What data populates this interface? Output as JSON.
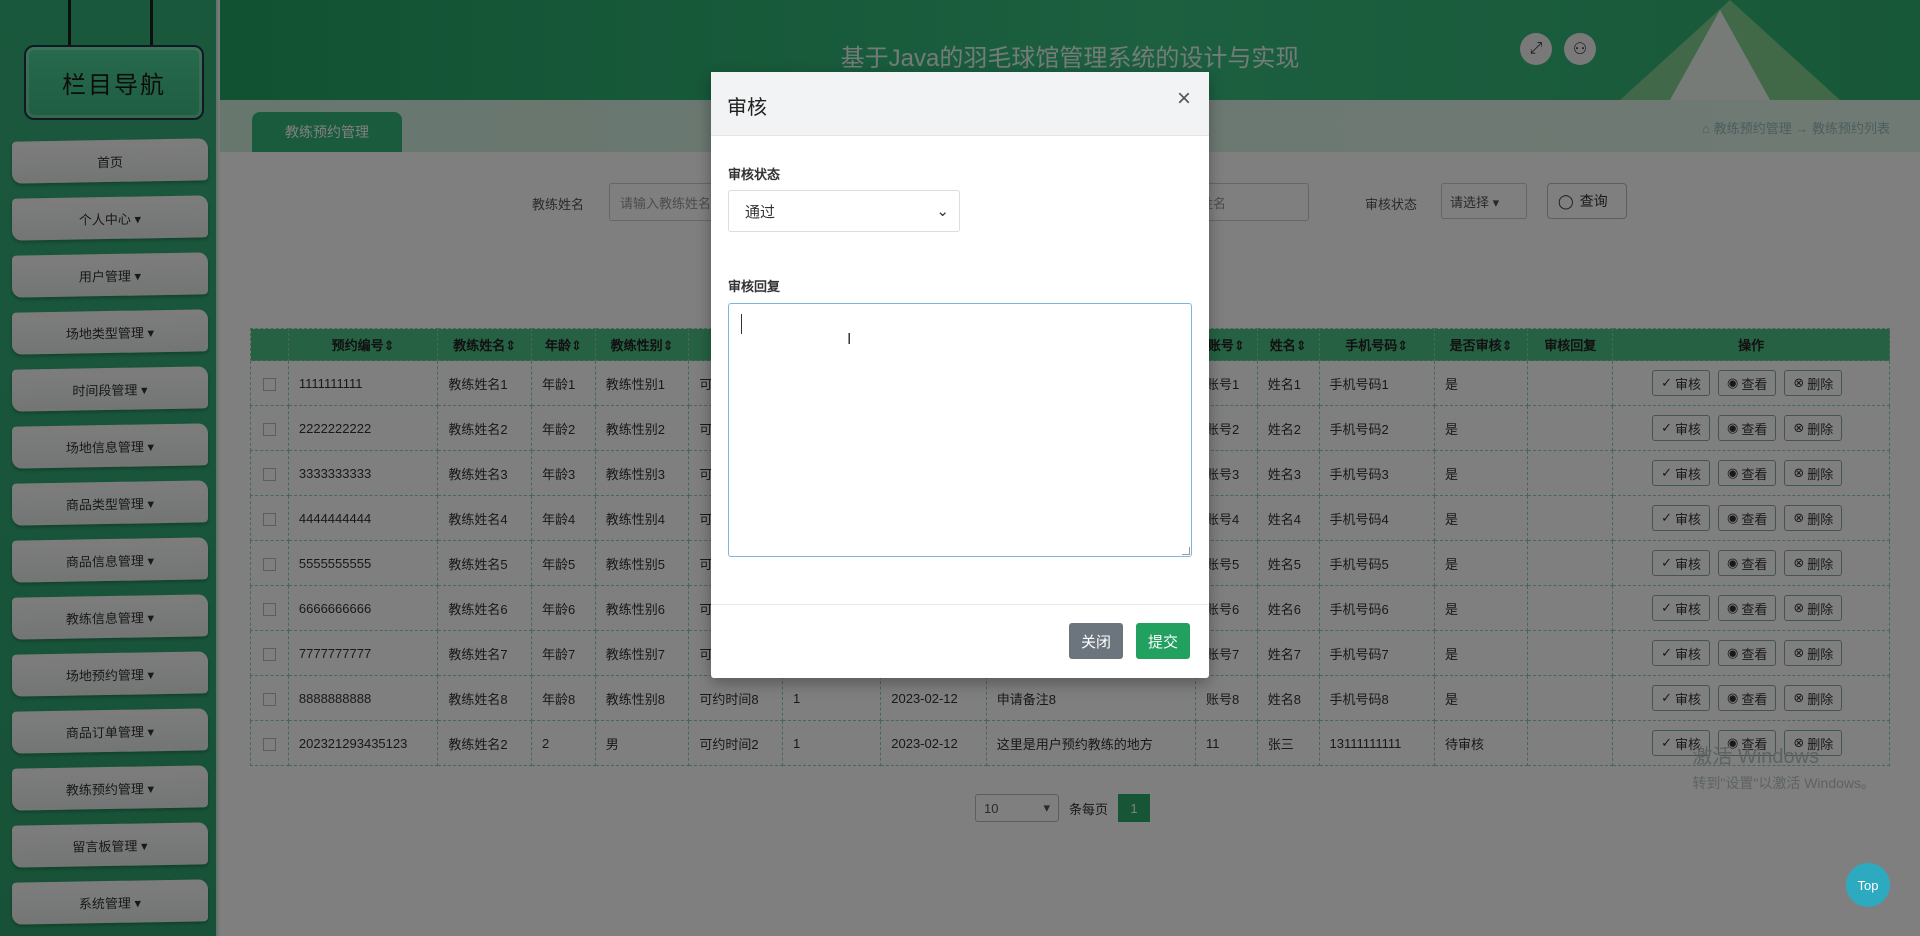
{
  "sidebar": {
    "title": "栏目导航",
    "items": [
      {
        "label": "首页"
      },
      {
        "label": "个人中心 ▾"
      },
      {
        "label": "用户管理 ▾"
      },
      {
        "label": "场地类型管理 ▾"
      },
      {
        "label": "时间段管理 ▾"
      },
      {
        "label": "场地信息管理 ▾"
      },
      {
        "label": "商品类型管理 ▾"
      },
      {
        "label": "商品信息管理 ▾"
      },
      {
        "label": "教练信息管理 ▾"
      },
      {
        "label": "场地预约管理 ▾"
      },
      {
        "label": "商品订单管理 ▾"
      },
      {
        "label": "教练预约管理 ▾"
      },
      {
        "label": "留言板管理 ▾"
      },
      {
        "label": "系统管理 ▾"
      }
    ]
  },
  "header": {
    "title": "基于Java的羽毛球馆管理系统的设计与实现",
    "fullscreen_icon": "⤢",
    "user_icon": "⚇"
  },
  "tabs": {
    "active": "教练预约管理",
    "breadcrumb": "⌂ 教练预约管理 → 教练预约列表"
  },
  "search": {
    "coach_label": "教练姓名",
    "coach_placeholder": "请输入教练姓名",
    "name_placeholder": "姓名",
    "status_label": "审核状态",
    "status_value": "请选择 ▾",
    "query_label": "查询"
  },
  "table": {
    "headers": [
      "",
      "预约编号⇕",
      "教练姓名⇕",
      "年龄⇕",
      "教练性别⇕",
      "可",
      "",
      "",
      "",
      "账号⇕",
      "姓名⇕",
      "手机号码⇕",
      "是否审核⇕",
      "审核回复",
      "操作"
    ],
    "rows": [
      [
        "1111111111",
        "教练姓名1",
        "年龄1",
        "教练性别1",
        "可",
        "",
        "",
        "",
        "账号1",
        "姓名1",
        "手机号码1",
        "是",
        ""
      ],
      [
        "2222222222",
        "教练姓名2",
        "年龄2",
        "教练性别2",
        "可",
        "",
        "",
        "",
        "账号2",
        "姓名2",
        "手机号码2",
        "是",
        ""
      ],
      [
        "3333333333",
        "教练姓名3",
        "年龄3",
        "教练性别3",
        "可",
        "",
        "",
        "",
        "账号3",
        "姓名3",
        "手机号码3",
        "是",
        ""
      ],
      [
        "4444444444",
        "教练姓名4",
        "年龄4",
        "教练性别4",
        "可",
        "",
        "",
        "",
        "账号4",
        "姓名4",
        "手机号码4",
        "是",
        ""
      ],
      [
        "5555555555",
        "教练姓名5",
        "年龄5",
        "教练性别5",
        "可",
        "",
        "",
        "",
        "账号5",
        "姓名5",
        "手机号码5",
        "是",
        ""
      ],
      [
        "6666666666",
        "教练姓名6",
        "年龄6",
        "教练性别6",
        "可",
        "",
        "",
        "",
        "账号6",
        "姓名6",
        "手机号码6",
        "是",
        ""
      ],
      [
        "7777777777",
        "教练姓名7",
        "年龄7",
        "教练性别7",
        "可",
        "",
        "",
        "",
        "账号7",
        "姓名7",
        "手机号码7",
        "是",
        ""
      ],
      [
        "8888888888",
        "教练姓名8",
        "年龄8",
        "教练性别8",
        "可约时间8",
        "1",
        "2023-02-12",
        "申请备注8",
        "账号8",
        "姓名8",
        "手机号码8",
        "是",
        ""
      ],
      [
        "202321293435123",
        "教练姓名2",
        "2",
        "男",
        "可约时间2",
        "1",
        "2023-02-12",
        "这里是用户预约教练的地方",
        "11",
        "张三",
        "13111111111",
        "待审核",
        ""
      ]
    ],
    "actions": {
      "review": "审核",
      "view": "查看",
      "delete": "删除"
    }
  },
  "pager": {
    "size": "10",
    "size_suffix": "条每页",
    "current": "1"
  },
  "watermark": {
    "line1": "激活 Windows",
    "line2": "转到\"设置\"以激活 Windows。"
  },
  "top_button": "Top",
  "modal": {
    "title": "审核",
    "close": "×",
    "status_label": "审核状态",
    "status_value": "通过",
    "reply_label": "审核回复",
    "reply_value": "",
    "close_button": "关闭",
    "submit_button": "提交"
  },
  "colors": {
    "brand": "#2eaa6e",
    "close_btn": "#6c757d",
    "submit_btn": "#22a060"
  }
}
